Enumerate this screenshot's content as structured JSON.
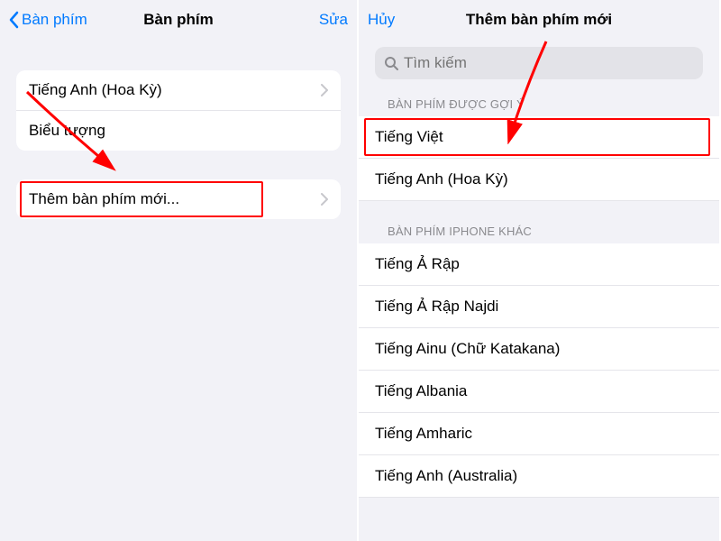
{
  "left": {
    "nav": {
      "back": "Bàn phím",
      "title": "Bàn phím",
      "edit": "Sửa"
    },
    "keyboards": [
      {
        "label": "Tiếng Anh (Hoa Kỳ)",
        "disclosure": true
      },
      {
        "label": "Biểu tượng",
        "disclosure": false
      }
    ],
    "add_label": "Thêm bàn phím mới...",
    "highlight_index": "add"
  },
  "right": {
    "nav": {
      "cancel": "Hủy",
      "title": "Thêm bàn phím mới"
    },
    "search_placeholder": "Tìm kiếm",
    "suggested_header": "BÀN PHÍM ĐƯỢC GỢI Ý",
    "suggested": [
      {
        "label": "Tiếng Việt"
      },
      {
        "label": "Tiếng Anh (Hoa Kỳ)"
      }
    ],
    "highlight_index": 0,
    "other_header": "BÀN PHÍM IPHONE KHÁC",
    "other": [
      {
        "label": "Tiếng Ả Rập"
      },
      {
        "label": "Tiếng Ả Rập Najdi"
      },
      {
        "label": "Tiếng Ainu (Chữ Katakana)"
      },
      {
        "label": "Tiếng Albania"
      },
      {
        "label": "Tiếng Amharic"
      },
      {
        "label": "Tiếng Anh (Australia)"
      }
    ]
  },
  "colors": {
    "accent": "#007aff",
    "annotation": "#ff0000"
  }
}
